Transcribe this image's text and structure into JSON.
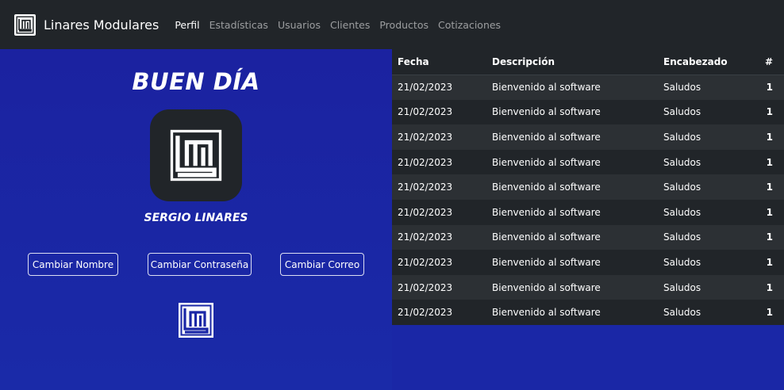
{
  "navbar": {
    "brand": "Linares Modulares",
    "links": [
      "Perfil",
      "Estadísticas",
      "Usuarios",
      "Clientes",
      "Productos",
      "Cotizaciones"
    ],
    "active": "Perfil"
  },
  "profile": {
    "greeting": "BUEN DÍA",
    "name": "SERGIO LINARES",
    "buttons": {
      "change_name": "Cambiar Nombre",
      "change_password": "Cambiar Contraseña",
      "change_email": "Cambiar Correo"
    }
  },
  "table": {
    "headers": [
      "Fecha",
      "Descripción",
      "Encabezado",
      "#"
    ],
    "rows": [
      [
        "21/02/2023",
        "Bienvenido al software",
        "Saludos",
        "1"
      ],
      [
        "21/02/2023",
        "Bienvenido al software",
        "Saludos",
        "1"
      ],
      [
        "21/02/2023",
        "Bienvenido al software",
        "Saludos",
        "1"
      ],
      [
        "21/02/2023",
        "Bienvenido al software",
        "Saludos",
        "1"
      ],
      [
        "21/02/2023",
        "Bienvenido al software",
        "Saludos",
        "1"
      ],
      [
        "21/02/2023",
        "Bienvenido al software",
        "Saludos",
        "1"
      ],
      [
        "21/02/2023",
        "Bienvenido al software",
        "Saludos",
        "1"
      ],
      [
        "21/02/2023",
        "Bienvenido al software",
        "Saludos",
        "1"
      ],
      [
        "21/02/2023",
        "Bienvenido al software",
        "Saludos",
        "1"
      ],
      [
        "21/02/2023",
        "Bienvenido al software",
        "Saludos",
        "1"
      ]
    ]
  },
  "colors": {
    "navbar": "#212529",
    "background": "#1a27a6",
    "table_odd": "#2c3034",
    "table_even": "#212529"
  },
  "icons": {
    "brand": "lm-logo-icon",
    "avatar": "lm-logo-icon",
    "footer": "lm-logo-icon"
  }
}
